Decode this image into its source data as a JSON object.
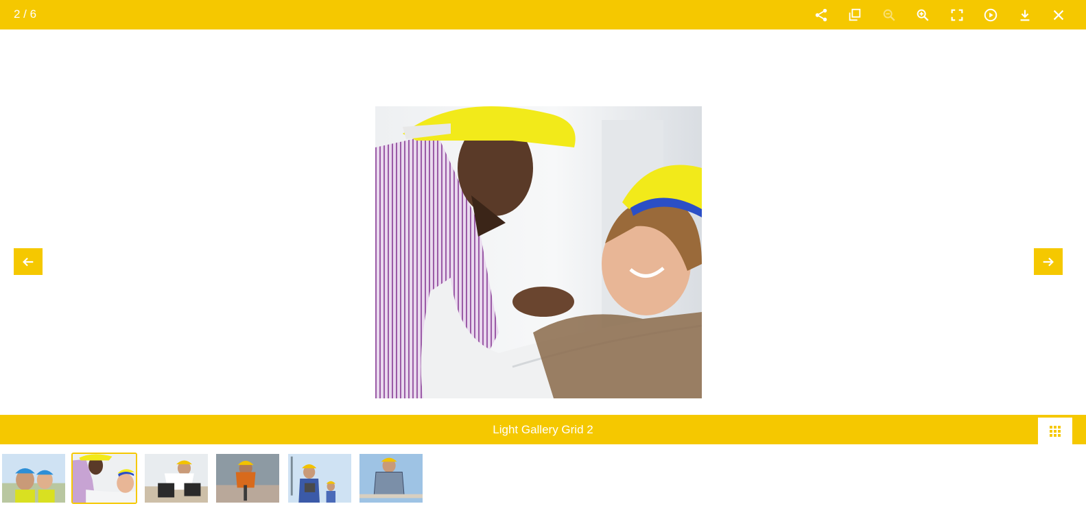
{
  "counter": "2 / 6",
  "toolbar": {
    "icons": [
      "share-icon",
      "copy-icon",
      "zoom-out-icon",
      "zoom-in-icon",
      "fullscreen-icon",
      "play-icon",
      "download-icon",
      "close-icon"
    ]
  },
  "caption": "Light Gallery Grid 2",
  "colors": {
    "accent": "#f5c800",
    "icon": "#ffffff"
  },
  "thumbnails": {
    "count": 6,
    "active_index": 2
  }
}
